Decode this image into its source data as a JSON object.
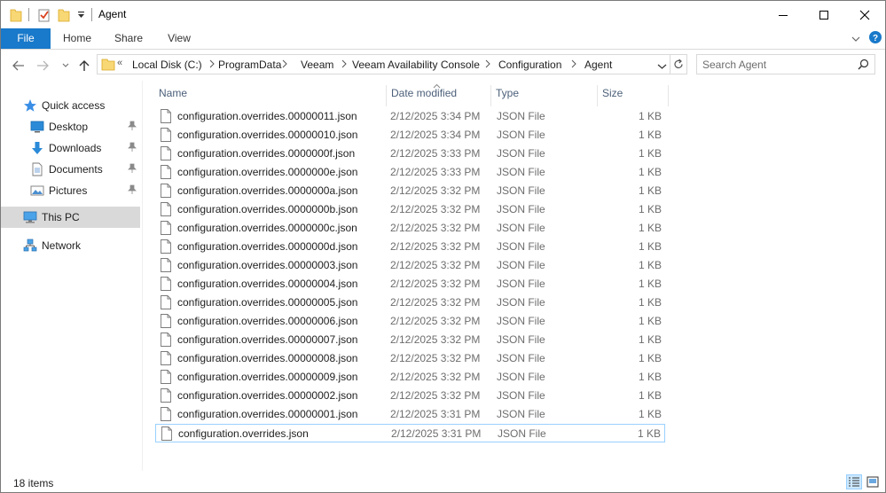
{
  "window": {
    "title": "Agent",
    "controls": [
      "minimize",
      "maximize",
      "close"
    ]
  },
  "ribbon": {
    "tabs": [
      "File",
      "Home",
      "Share",
      "View"
    ]
  },
  "address": {
    "overflow": "«",
    "crumbs": [
      "Local Disk (C:)",
      "ProgramData",
      "Veeam",
      "Veeam Availability Console",
      "Configuration",
      "Agent"
    ]
  },
  "search": {
    "placeholder": "Search Agent"
  },
  "sidebar": {
    "items": [
      {
        "label": "Quick access",
        "icon": "star-icon"
      },
      {
        "label": "Desktop",
        "icon": "desktop-icon"
      },
      {
        "label": "Downloads",
        "icon": "download-icon"
      },
      {
        "label": "Documents",
        "icon": "document-icon"
      },
      {
        "label": "Pictures",
        "icon": "pictures-icon"
      },
      {
        "label": "This PC",
        "icon": "computer-icon"
      },
      {
        "label": "Network",
        "icon": "network-icon"
      }
    ]
  },
  "columns": {
    "name": "Name",
    "date": "Date modified",
    "type": "Type",
    "size": "Size"
  },
  "files": [
    {
      "name": "configuration.overrides.00000011.json",
      "date": "2/12/2025 3:34 PM",
      "type": "JSON File",
      "size": "1 KB"
    },
    {
      "name": "configuration.overrides.00000010.json",
      "date": "2/12/2025 3:34 PM",
      "type": "JSON File",
      "size": "1 KB"
    },
    {
      "name": "configuration.overrides.0000000f.json",
      "date": "2/12/2025 3:33 PM",
      "type": "JSON File",
      "size": "1 KB"
    },
    {
      "name": "configuration.overrides.0000000e.json",
      "date": "2/12/2025 3:33 PM",
      "type": "JSON File",
      "size": "1 KB"
    },
    {
      "name": "configuration.overrides.0000000a.json",
      "date": "2/12/2025 3:32 PM",
      "type": "JSON File",
      "size": "1 KB"
    },
    {
      "name": "configuration.overrides.0000000b.json",
      "date": "2/12/2025 3:32 PM",
      "type": "JSON File",
      "size": "1 KB"
    },
    {
      "name": "configuration.overrides.0000000c.json",
      "date": "2/12/2025 3:32 PM",
      "type": "JSON File",
      "size": "1 KB"
    },
    {
      "name": "configuration.overrides.0000000d.json",
      "date": "2/12/2025 3:32 PM",
      "type": "JSON File",
      "size": "1 KB"
    },
    {
      "name": "configuration.overrides.00000003.json",
      "date": "2/12/2025 3:32 PM",
      "type": "JSON File",
      "size": "1 KB"
    },
    {
      "name": "configuration.overrides.00000004.json",
      "date": "2/12/2025 3:32 PM",
      "type": "JSON File",
      "size": "1 KB"
    },
    {
      "name": "configuration.overrides.00000005.json",
      "date": "2/12/2025 3:32 PM",
      "type": "JSON File",
      "size": "1 KB"
    },
    {
      "name": "configuration.overrides.00000006.json",
      "date": "2/12/2025 3:32 PM",
      "type": "JSON File",
      "size": "1 KB"
    },
    {
      "name": "configuration.overrides.00000007.json",
      "date": "2/12/2025 3:32 PM",
      "type": "JSON File",
      "size": "1 KB"
    },
    {
      "name": "configuration.overrides.00000008.json",
      "date": "2/12/2025 3:32 PM",
      "type": "JSON File",
      "size": "1 KB"
    },
    {
      "name": "configuration.overrides.00000009.json",
      "date": "2/12/2025 3:32 PM",
      "type": "JSON File",
      "size": "1 KB"
    },
    {
      "name": "configuration.overrides.00000002.json",
      "date": "2/12/2025 3:32 PM",
      "type": "JSON File",
      "size": "1 KB"
    },
    {
      "name": "configuration.overrides.00000001.json",
      "date": "2/12/2025 3:31 PM",
      "type": "JSON File",
      "size": "1 KB"
    },
    {
      "name": "configuration.overrides.json",
      "date": "2/12/2025 3:31 PM",
      "type": "JSON File",
      "size": "1 KB"
    }
  ],
  "status": {
    "item_count": "18 items"
  },
  "colors": {
    "accent": "#1979ca",
    "selection": "#cce8ff",
    "focus_border": "#99d1ff",
    "header_text": "#4c607a"
  }
}
